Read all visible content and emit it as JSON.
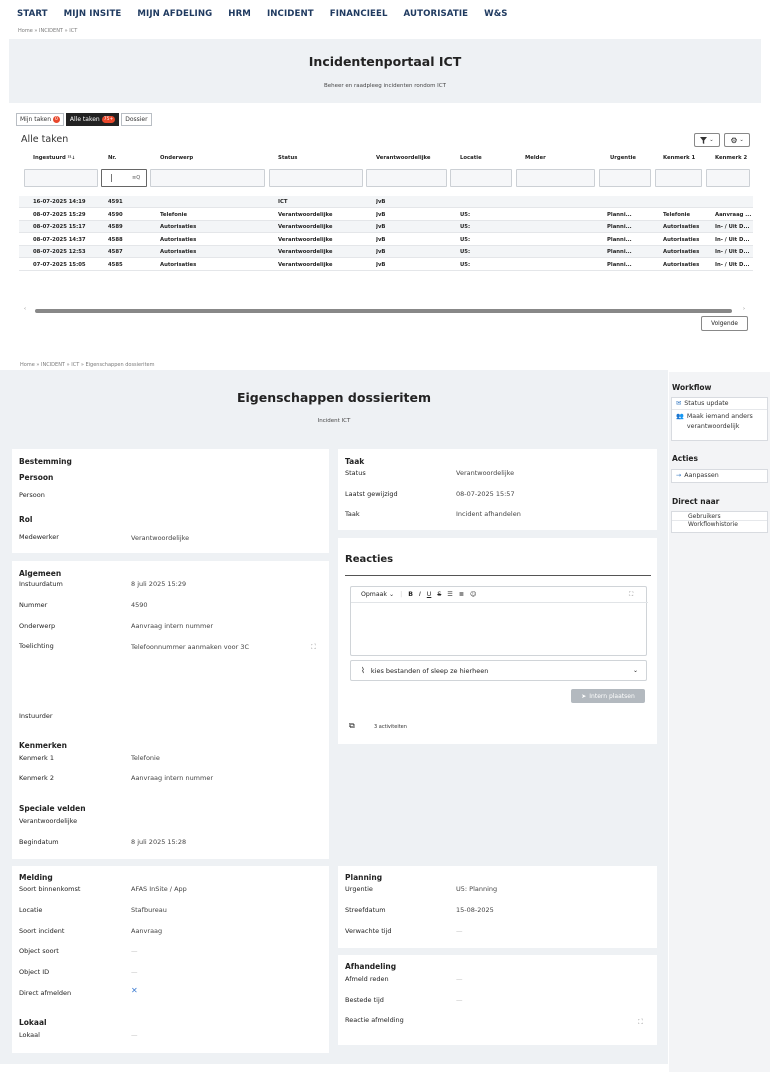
{
  "nav": [
    "START",
    "MIJN INSITE",
    "MIJN AFDELING",
    "HRM",
    "INCIDENT",
    "FINANCIEEL",
    "AUTORISATIE",
    "W&S"
  ],
  "breadcrumb1": "Home  »  INCIDENT  »  ICT",
  "portal": {
    "title": "Incidentenportaal ICT",
    "subtitle": "Beheer en raadpleeg incidenten rondom ICT"
  },
  "tabs": [
    {
      "label": "Mijn taken",
      "badge": "0"
    },
    {
      "label": "Alle taken",
      "badge": "75+"
    },
    {
      "label": "Dossier",
      "badge": ""
    }
  ],
  "list": {
    "title": "Alle taken",
    "filter_icon": "filter-icon",
    "settings_icon": "gear-icon",
    "columns": [
      "Ingestuurd",
      "Nr.",
      "Onderwerp",
      "Status",
      "Verantwoordelijke",
      "Locatie",
      "Melder",
      "Urgentie",
      "Kenmerk 1",
      "Kenmerk 2"
    ],
    "rows": [
      [
        "16-07-2025 14:19",
        "4591",
        "",
        "ICT",
        "JvB",
        "",
        "",
        "",
        "",
        ""
      ],
      [
        "08-07-2025 15:29",
        "4590",
        "Telefonie",
        "Verantwoordelijke",
        "JvB",
        "U5:",
        "",
        "Planni...",
        "Telefonie",
        "Aanvraag ..."
      ],
      [
        "08-07-2025 15:17",
        "4589",
        "Autorisaties",
        "Verantwoordelijke",
        "JvB",
        "U5:",
        "",
        "Planni...",
        "Autorisaties",
        "In- / Uit D..."
      ],
      [
        "08-07-2025 14:37",
        "4588",
        "Autorisaties",
        "Verantwoordelijke",
        "JvB",
        "U5:",
        "",
        "Planni...",
        "Autorisaties",
        "In- / Uit D..."
      ],
      [
        "08-07-2025 12:53",
        "4587",
        "Autorisaties",
        "Verantwoordelijke",
        "JvB",
        "U5:",
        "",
        "Planni...",
        "Autorisaties",
        "In- / Uit D..."
      ],
      [
        "07-07-2025 15:05",
        "4585",
        "Autorisaties",
        "Verantwoordelijke",
        "JvB",
        "U5:",
        "",
        "Planni...",
        "Autorisaties",
        "In- / Uit D..."
      ]
    ],
    "next_label": "Volgende"
  },
  "breadcrumb2": "Home  »  INCIDENT  »  ICT  »  Eigenschappen dossieritem",
  "detail": {
    "title": "Eigenschappen dossieritem",
    "subtitle": "Incident ICT",
    "bestemming": {
      "header": "Bestemming",
      "persoon_h": "Persoon",
      "persoon": "Persoon",
      "rol_h": "Rol",
      "medewerker": "Medewerker",
      "medewerker_val": "Verantwoordelijke"
    },
    "algemeen": {
      "header": "Algemeen",
      "instuurdatum": "Instuurdatum",
      "instuurdatum_val": "8 juli 2025 15:29",
      "nummer": "Nummer",
      "nummer_val": "4590",
      "onderwerp": "Onderwerp",
      "onderwerp_val": "Aanvraag intern nummer",
      "toelichting": "Toelichting",
      "toelichting_val": "Telefoonnummer aanmaken voor 3C",
      "instuurder": "Instuurder"
    },
    "kenmerken": {
      "header": "Kenmerken",
      "k1": "Kenmerk 1",
      "k1_val": "Telefonie",
      "k2": "Kenmerk 2",
      "k2_val": "Aanvraag intern nummer"
    },
    "speciaal": {
      "header": "Speciale velden",
      "verantw": "Verantwoordelijke",
      "begindatum": "Begindatum",
      "begindatum_val": "8 juli 2025 15:28"
    },
    "melding": {
      "header": "Melding",
      "soort": "Soort binnenkomst",
      "soort_val": "AFAS InSite / App",
      "locatie": "Locatie",
      "locatie_val": "Stafbureau",
      "soort_inc": "Soort incident",
      "soort_inc_val": "Aanvraag",
      "obj_soort": "Object soort",
      "obj_soort_val": "—",
      "obj_id": "Object ID",
      "obj_id_val": "—",
      "direct": "Direct afmelden",
      "direct_val": "✕"
    },
    "lokaal": {
      "header": "Lokaal",
      "lokaal": "Lokaal",
      "lokaal_val": "—"
    },
    "taak": {
      "header": "Taak",
      "status": "Status",
      "status_val": "Verantwoordelijke",
      "gewijzigd": "Laatst gewijzigd",
      "gewijzigd_val": "08-07-2025 15:57",
      "taak": "Taak",
      "taak_val": "Incident afhandelen"
    },
    "reacties": {
      "header": "Reacties",
      "opmaak": "Opmaak",
      "upload": "kies bestanden of sleep ze hierheen",
      "plaatsen": "Intern plaatsen",
      "activiteiten": "3 activiteiten"
    },
    "planning": {
      "header": "Planning",
      "urgentie": "Urgentie",
      "urgentie_val": "U5: Planning",
      "streef": "Streefdatum",
      "streef_val": "15-08-2025",
      "verwacht": "Verwachte tijd",
      "verwacht_val": "—"
    },
    "afhandeling": {
      "header": "Afhandeling",
      "afmeld": "Afmeld reden",
      "afmeld_val": "—",
      "bestede": "Bestede tijd",
      "bestede_val": "—",
      "reactie": "Reactie afmelding"
    }
  },
  "sidebar": {
    "workflow_h": "Workflow",
    "status_update": "Status update",
    "maak": "Maak iemand anders verantwoordelijk",
    "acties_h": "Acties",
    "aanpassen": "Aanpassen",
    "direct_h": "Direct naar",
    "gebruikers": "Gebruikers",
    "workflowhistorie": "Workflowhistorie"
  }
}
